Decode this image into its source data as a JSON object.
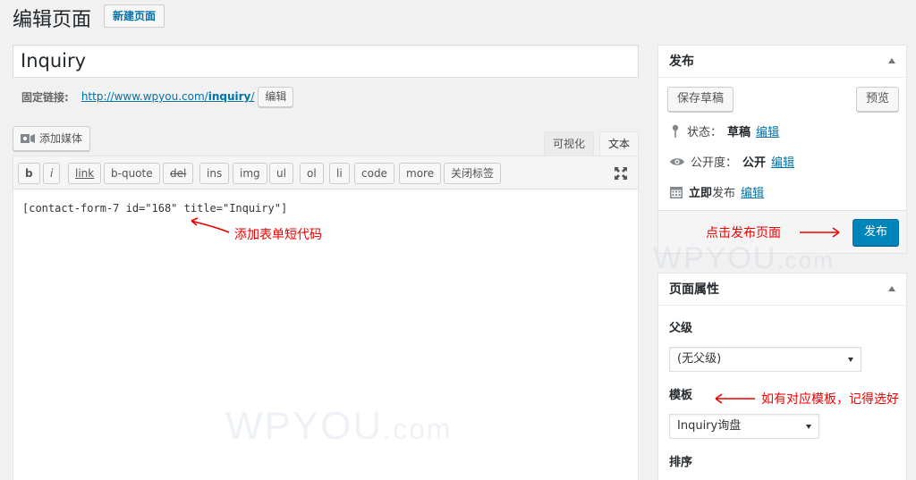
{
  "header": {
    "title": "编辑页面",
    "add_new_label": "新建页面"
  },
  "post": {
    "title": "Inquiry",
    "permalink_label": "固定链接:",
    "permalink_base": "http://www.wpyou.com/",
    "permalink_slug": "inquiry",
    "permalink_trail": "/",
    "permalink_edit_label": "编辑"
  },
  "editor": {
    "add_media_label": "添加媒体",
    "tabs": {
      "visual": "可视化",
      "text": "文本"
    },
    "quicktags": [
      "b",
      "i",
      "link",
      "b-quote",
      "del",
      "ins",
      "img",
      "ul",
      "ol",
      "li",
      "code",
      "more",
      "关闭标签"
    ],
    "content": "[contact-form-7 id=\"168\" title=\"Inquiry\"]"
  },
  "annotations": {
    "shortcode": "添加表单短代码",
    "publish": "点击发布页面",
    "template": "如有对应模板，记得选好"
  },
  "watermark": {
    "main": "WPYOU",
    "suffix": ".com"
  },
  "publish_box": {
    "title": "发布",
    "save_draft_label": "保存草稿",
    "preview_label": "预览",
    "status_label": "状态：",
    "status_value": "草稿",
    "visibility_label": "公开度：",
    "visibility_value": "公开",
    "schedule_label_bold": "立即",
    "schedule_label": "发布",
    "edit_label": "编辑",
    "publish_label": "发布"
  },
  "attributes_box": {
    "title": "页面属性",
    "parent_label": "父级",
    "parent_value": "(无父级)",
    "template_label": "模板",
    "template_value": "Inquiry询盘",
    "order_label": "排序"
  },
  "colors": {
    "accent": "#0085ba",
    "link": "#0073aa",
    "annotation": "#e00000"
  }
}
